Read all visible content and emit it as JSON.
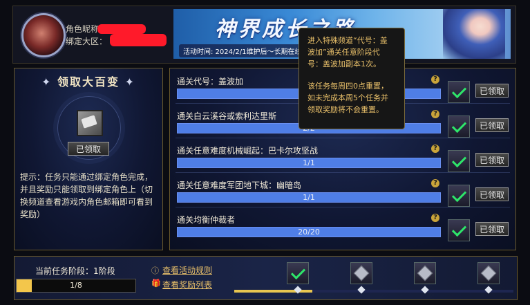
{
  "header": {
    "role_name_label": "角色昵称：",
    "bind_region_label": "绑定大区：",
    "banner_title": "神界成长之路",
    "banner_time": "活动时间: 2024/2/1维护后～长期在线"
  },
  "tooltip": {
    "line1": "进入特殊频道“代号：盖\n波加”通关任意阶段代\n号：盖波加副本1次。",
    "line2": "该任务每周四0点重置，\n如未完成本周5个任务并\n领取奖励将不会重置。"
  },
  "reward_panel": {
    "title": "领取大百变",
    "claim_label": "已领取",
    "hint": "提示：任务只能通过绑定角色完成，并且奖励只能领取到绑定角色上（切换频道查看游戏内角色邮箱即可看到奖励）"
  },
  "tasks": [
    {
      "name": "通关代号：盖波加",
      "progress": "1/1",
      "claim_label": "已领取"
    },
    {
      "name": "通关白云溪谷或索利达里斯",
      "progress": "2/2",
      "claim_label": "已领取"
    },
    {
      "name": "通关任意难度机械崛起：巴卡尔攻坚战",
      "progress": "1/1",
      "claim_label": "已领取"
    },
    {
      "name": "通关任意难度军团地下城：幽暗岛",
      "progress": "1/1",
      "claim_label": "已领取"
    },
    {
      "name": "通关均衡仲裁者",
      "progress": "20/20",
      "claim_label": "已领取"
    }
  ],
  "bottom": {
    "stage_label": "当前任务阶段：1阶段",
    "stage_progress": "1/8",
    "stage_fraction": 0.125,
    "rules_link": "查看活动规则",
    "rewards_link": "查看奖励列表",
    "track_fraction": 0.28
  },
  "colors": {
    "accent": "#e9c06a",
    "check": "#2ee66a",
    "bar": "#4f7ee6",
    "stage_fill": "#f3c64b"
  }
}
